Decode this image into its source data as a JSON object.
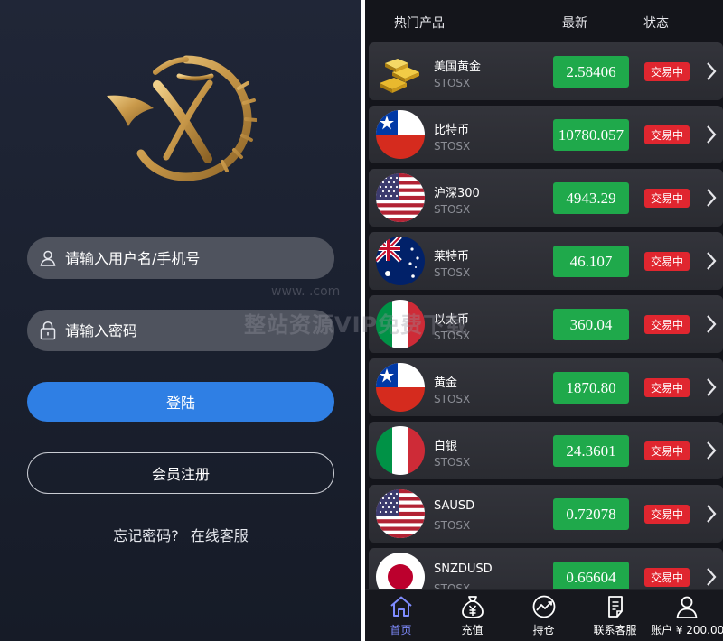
{
  "login": {
    "username_placeholder": "请输入用户名/手机号",
    "password_placeholder": "请输入密码",
    "login_label": "登陆",
    "register_label": "会员注册",
    "forgot_label": "忘记密码?",
    "service_label": "在线客服",
    "user_icon": "user-icon",
    "lock_icon": "lock-icon"
  },
  "market": {
    "header": {
      "product": "热门产品",
      "latest": "最新",
      "status": "状态"
    },
    "rows": [
      {
        "name": "美国黄金",
        "code": "STOSX",
        "price": "2.58406",
        "status": "交易中",
        "icon": "gold-bars"
      },
      {
        "name": "比特币",
        "code": "STOSX",
        "price": "10780.057",
        "status": "交易中",
        "icon": "flag-chile"
      },
      {
        "name": "沪深300",
        "code": "STOSX",
        "price": "4943.29",
        "status": "交易中",
        "icon": "flag-usa"
      },
      {
        "name": "莱特币",
        "code": "STOSX",
        "price": "46.107",
        "status": "交易中",
        "icon": "flag-australia"
      },
      {
        "name": "以太币",
        "code": "STOSX",
        "price": "360.04",
        "status": "交易中",
        "icon": "flag-italy"
      },
      {
        "name": "黄金",
        "code": "STOSX",
        "price": "1870.80",
        "status": "交易中",
        "icon": "flag-chile"
      },
      {
        "name": "白银",
        "code": "STOSX",
        "price": "24.3601",
        "status": "交易中",
        "icon": "flag-italy"
      },
      {
        "name": "SAUSD",
        "code": "STOSX",
        "price": "0.72078",
        "status": "交易中",
        "icon": "flag-usa"
      },
      {
        "name": "SNZDUSD",
        "code": "STOSX",
        "price": "0.66604",
        "status": "交易中",
        "icon": "flag-japan"
      }
    ]
  },
  "tabbar": {
    "tabs": [
      {
        "label": "首页",
        "icon": "home-icon"
      },
      {
        "label": "充值",
        "icon": "money-bag-icon"
      },
      {
        "label": "持仓",
        "icon": "chart-icon"
      },
      {
        "label": "联系客服",
        "icon": "document-icon"
      },
      {
        "label": "账户 ¥ 200.00",
        "icon": "user-icon"
      }
    ],
    "active": 0
  },
  "watermark": {
    "text": "整站资源VIP免费下载",
    "url": "www.       .com"
  },
  "colors": {
    "login_bg": "#1b2130",
    "input_bg": "#4f535e",
    "primary": "#2f7fe4",
    "price_green": "#1fa94b",
    "status_red": "#e0262f",
    "active_tab": "#7f8cff",
    "logo_gold": "#c9994a"
  }
}
